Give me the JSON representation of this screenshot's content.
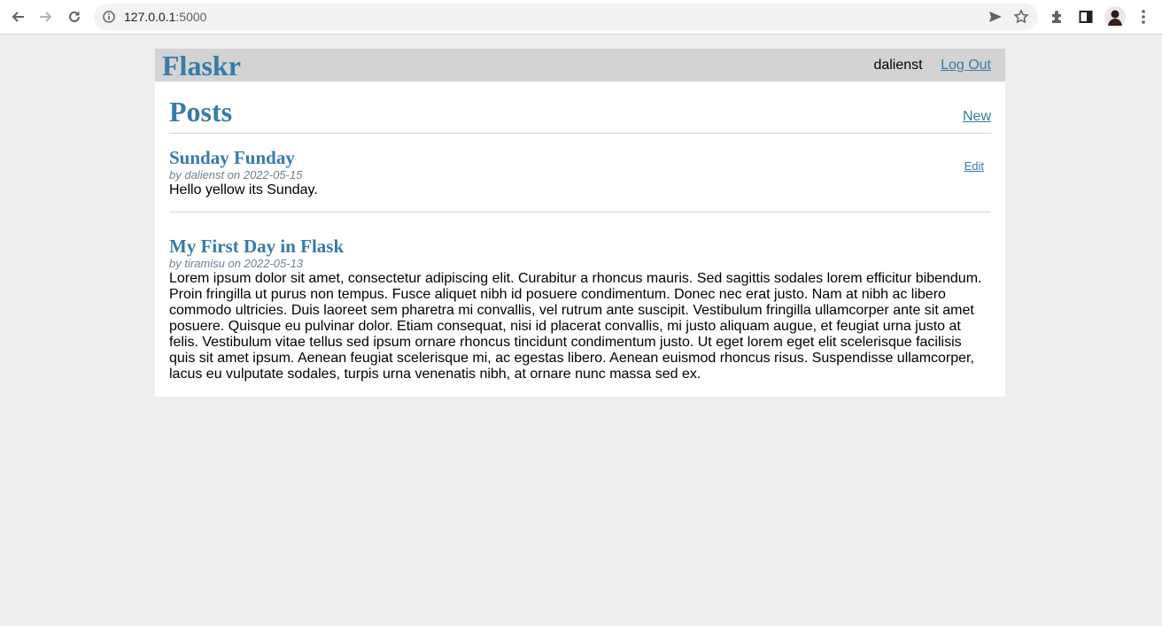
{
  "browser": {
    "url_host": "127.0.0.1",
    "url_port": ":5000"
  },
  "nav": {
    "brand": "Flaskr",
    "username": "dalienst",
    "logout_label": "Log Out"
  },
  "header": {
    "title": "Posts",
    "new_label": "New"
  },
  "posts": [
    {
      "title": "Sunday Funday",
      "about": "by dalienst on 2022-05-15",
      "body": "Hello yellow its Sunday.",
      "edit_label": "Edit"
    },
    {
      "title": "My First Day in Flask",
      "about": "by tiramisu on 2022-05-13",
      "body": "Lorem ipsum dolor sit amet, consectetur adipiscing elit. Curabitur a rhoncus mauris. Sed sagittis sodales lorem efficitur bibendum. Proin fringilla ut purus non tempus. Fusce aliquet nibh id posuere condimentum. Donec nec erat justo. Nam at nibh ac libero commodo ultricies. Duis laoreet sem pharetra mi convallis, vel rutrum ante suscipit. Vestibulum fringilla ullamcorper ante sit amet posuere. Quisque eu pulvinar dolor. Etiam consequat, nisi id placerat convallis, mi justo aliquam augue, et feugiat urna justo at felis. Vestibulum vitae tellus sed ipsum ornare rhoncus tincidunt condimentum justo. Ut eget lorem eget elit scelerisque facilisis quis sit amet ipsum. Aenean feugiat scelerisque mi, ac egestas libero. Aenean euismod rhoncus risus. Suspendisse ullamcorper, lacus eu vulputate sodales, turpis urna venenatis nibh, at ornare nunc massa sed ex."
    }
  ],
  "colors": {
    "link": "#377ba8",
    "nav_bg": "#d3d3d3",
    "page_bg": "#eeeeee",
    "meta": "slategray"
  },
  "icons": [
    "back-arrow-icon",
    "forward-arrow-icon",
    "reload-icon",
    "info-icon",
    "send-icon",
    "star-icon",
    "extensions-icon",
    "side-panel-icon",
    "profile-avatar",
    "more-menu-icon"
  ]
}
